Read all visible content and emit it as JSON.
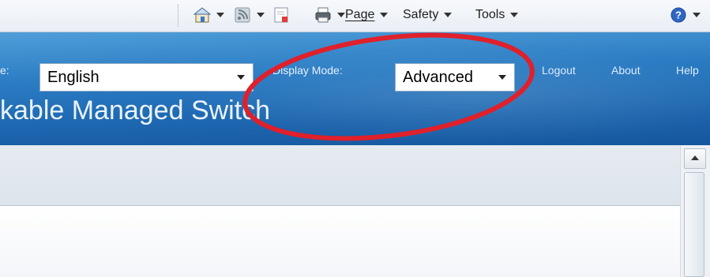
{
  "command_bar": {
    "page_label": "Page",
    "safety_label": "Safety",
    "tools_label": "Tools",
    "icons": [
      "home-icon",
      "feeds-icon",
      "read-mail-icon",
      "print-icon",
      "help-icon"
    ]
  },
  "header": {
    "language_label_fragment": "e:",
    "language_value": "English",
    "display_mode_label": "Display Mode:",
    "display_mode_value": "Advanced",
    "links": {
      "logout": "Logout",
      "about": "About",
      "help": "Help"
    },
    "product_title_fragment": "kable Managed Switch"
  },
  "colors": {
    "header_blue": "#2a7bc3",
    "annotation_red": "#e0202a",
    "toolbar_band": "#e3e9ef"
  }
}
